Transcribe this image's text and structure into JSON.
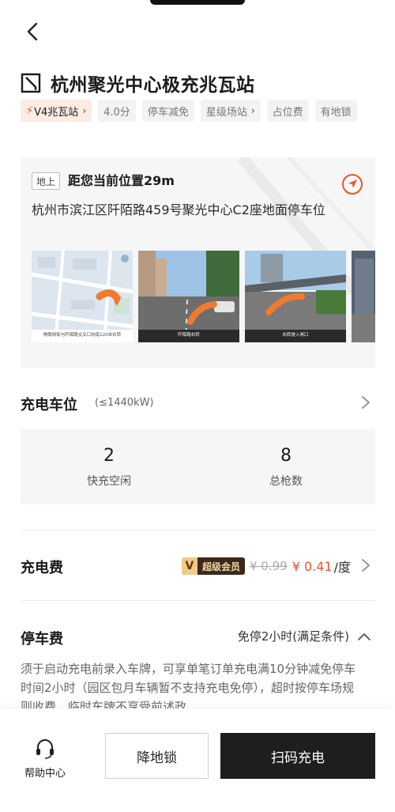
{
  "header": {
    "back_icon": "chevron-left-icon",
    "station_icon": "station-logo-icon",
    "station_name": "杭州聚光中心极充兆瓦站"
  },
  "tags": [
    {
      "text": "V4兆瓦站",
      "highlight": true,
      "has_bolt": true,
      "has_chevron": true
    },
    {
      "text": "4.0分"
    },
    {
      "text": "停车减免"
    },
    {
      "text": "星级场站",
      "has_chevron": true
    },
    {
      "text": "占位费"
    },
    {
      "text": "有地锁"
    }
  ],
  "location": {
    "ground_badge": "地上",
    "distance": "距您当前位置29m",
    "address": "杭州市滨江区阡陌路459号聚光中心C2座地面停车位",
    "nav_icon": "navigation-arrow-icon",
    "photos": [
      {
        "caption": "物联网街与阡陌路交叉口向南120米右转",
        "kind": "map"
      },
      {
        "caption": "阡陌路右转",
        "kind": "street"
      },
      {
        "caption": "右转驶入闸口",
        "kind": "gate"
      },
      {
        "caption": "",
        "kind": "building"
      }
    ]
  },
  "charging_spots": {
    "title": "充电车位",
    "power_limit": "(≤1440kW)",
    "stats": [
      {
        "value": "2",
        "label": "快充空闲"
      },
      {
        "value": "8",
        "label": "总枪数"
      }
    ]
  },
  "charging_fee": {
    "title": "充电费",
    "member_v": "V",
    "member_label": "超级会员",
    "original_price": "¥ 0.99",
    "member_price": "¥ 0.41",
    "unit": "/度"
  },
  "parking_fee": {
    "title": "停车费",
    "condition": "免停2小时(满足条件)",
    "description": "须于启动充电前录入车牌，可享单笔订单充电满10分钟减免停车时间2小时（园区包月车辆暂不支持充电免停），超时按停车场规则收费，临时车牌不享受前述政"
  },
  "bottom_bar": {
    "help_icon": "headset-icon",
    "help_label": "帮助中心",
    "lock_button": "降地锁",
    "scan_button": "扫码充电"
  },
  "colors": {
    "accent": "#e8562e",
    "dark_button": "#1e1e1e",
    "tag_bg": "#f3f3f3",
    "highlight_tag_bg": "#fdebe4",
    "member_gold": "#f2c98a",
    "member_dark": "#3a2a1c"
  }
}
